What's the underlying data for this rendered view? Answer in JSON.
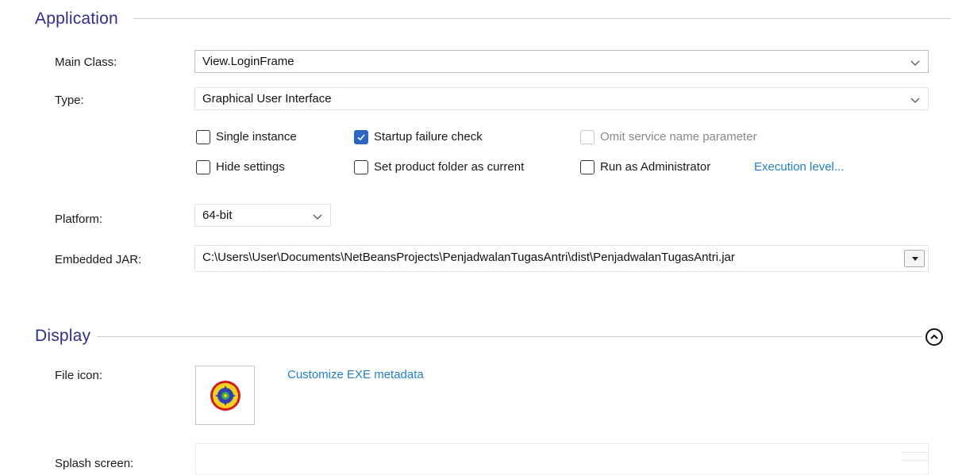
{
  "application": {
    "title": "Application",
    "main_class": {
      "label": "Main Class:",
      "value": "View.LoginFrame"
    },
    "type": {
      "label": "Type:",
      "value": "Graphical User Interface"
    },
    "checkboxes": [
      {
        "label": "Single instance",
        "checked": false,
        "disabled": false
      },
      {
        "label": "Startup failure check",
        "checked": true,
        "disabled": false
      },
      {
        "label": "Omit service name parameter",
        "checked": false,
        "disabled": true
      },
      {
        "label": "Hide settings",
        "checked": false,
        "disabled": false
      },
      {
        "label": "Set product folder as current",
        "checked": false,
        "disabled": false
      },
      {
        "label": "Run as Administrator",
        "checked": false,
        "disabled": false
      }
    ],
    "execution_level_link": "Execution level...",
    "platform": {
      "label": "Platform:",
      "value": "64-bit"
    },
    "embedded_jar": {
      "label": "Embedded JAR:",
      "value": "C:\\Users\\User\\Documents\\NetBeansProjects\\PenjadwalanTugasAntri\\dist\\PenjadwalanTugasAntri.jar"
    }
  },
  "display": {
    "title": "Display",
    "file_icon": {
      "label": "File icon:"
    },
    "customize_link": "Customize EXE metadata",
    "splash_screen": {
      "label": "Splash screen:"
    }
  },
  "colors": {
    "section_title": "#2b2f8f",
    "link": "#1f7fd4",
    "checkbox_checked": "#2c66c4"
  }
}
